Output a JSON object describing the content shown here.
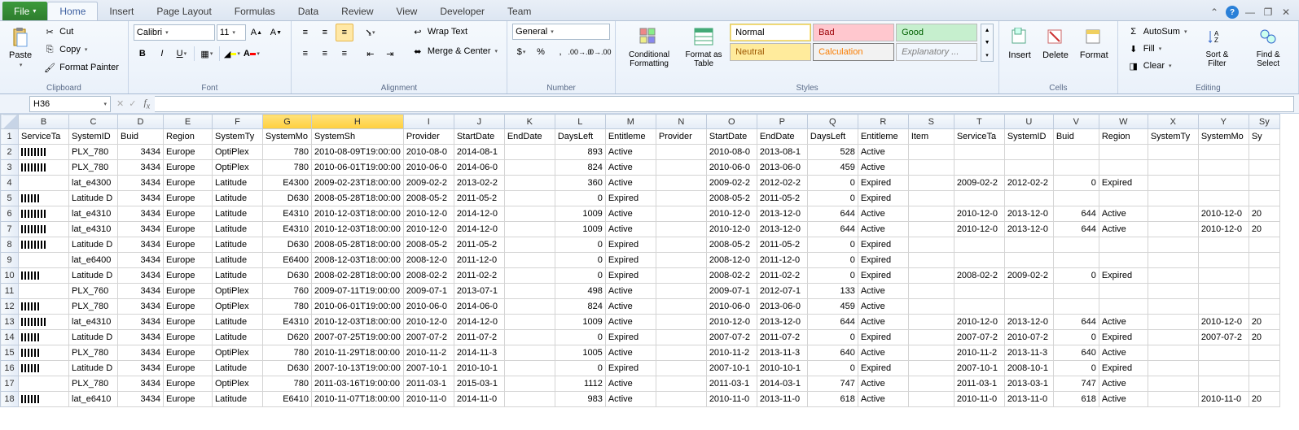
{
  "tabs": {
    "file": "File",
    "home": "Home",
    "insert": "Insert",
    "page_layout": "Page Layout",
    "formulas": "Formulas",
    "data": "Data",
    "review": "Review",
    "view": "View",
    "developer": "Developer",
    "team": "Team"
  },
  "clipboard": {
    "group": "Clipboard",
    "paste": "Paste",
    "cut": "Cut",
    "copy": "Copy",
    "format_painter": "Format Painter"
  },
  "font": {
    "group": "Font",
    "name": "Calibri",
    "size": "11"
  },
  "alignment": {
    "group": "Alignment",
    "wrap": "Wrap Text",
    "merge": "Merge & Center"
  },
  "number": {
    "group": "Number",
    "format": "General"
  },
  "styles": {
    "group": "Styles",
    "cond": "Conditional Formatting",
    "table": "Format as Table",
    "normal": "Normal",
    "bad": "Bad",
    "good": "Good",
    "neutral": "Neutral",
    "calc": "Calculation",
    "expl": "Explanatory ..."
  },
  "cells": {
    "group": "Cells",
    "insert": "Insert",
    "delete": "Delete",
    "format": "Format"
  },
  "editing": {
    "group": "Editing",
    "autosum": "AutoSum",
    "fill": "Fill",
    "clear": "Clear",
    "sort": "Sort & Filter",
    "find": "Find & Select"
  },
  "namebox": "H36",
  "columns": [
    "B",
    "C",
    "D",
    "E",
    "F",
    "G",
    "H",
    "I",
    "J",
    "K",
    "L",
    "M",
    "N",
    "O",
    "P",
    "Q",
    "R",
    "S",
    "T",
    "U",
    "V",
    "W",
    "X",
    "Y",
    "Sy"
  ],
  "headers": {
    "B": "ServiceTa",
    "C": "SystemID",
    "D": "Buid",
    "E": "Region",
    "F": "SystemTy",
    "G": "SystemMo",
    "H": "SystemSh",
    "I": "Provider",
    "J": "StartDate",
    "K": "EndDate",
    "L": "DaysLeft",
    "M": "Entitleme",
    "N": "Provider",
    "O": "StartDate",
    "P": "EndDate",
    "Q": "DaysLeft",
    "R": "Entitleme",
    "S": "Item",
    "T": "ServiceTa",
    "U": "SystemID",
    "V": "Buid",
    "W": "Region",
    "X": "SystemTy",
    "Y": "SystemMo",
    "Z": "Sy"
  },
  "rows": [
    {
      "n": 2,
      "bc": 1,
      "C": "PLX_780",
      "D": "3434",
      "E": "Europe",
      "F": "OptiPlex",
      "G": "780",
      "H": "2010-08-09T19:00:00",
      "I": "2010-08-0",
      "J": "2014-08-1",
      "K": "",
      "L": "893",
      "M": "Active",
      "O": "2010-08-0",
      "P": "2013-08-1",
      "Q": "528",
      "R": "Active"
    },
    {
      "n": 3,
      "bc": 1,
      "C": "PLX_780",
      "D": "3434",
      "E": "Europe",
      "F": "OptiPlex",
      "G": "780",
      "H": "2010-06-01T19:00:00",
      "I": "2010-06-0",
      "J": "2014-06-0",
      "K": "",
      "L": "824",
      "M": "Active",
      "O": "2010-06-0",
      "P": "2013-06-0",
      "Q": "459",
      "R": "Active"
    },
    {
      "n": 4,
      "bc": 0,
      "C": "lat_e4300",
      "D": "3434",
      "E": "Europe",
      "F": "Latitude",
      "G": "E4300",
      "H": "2009-02-23T18:00:00",
      "I": "2009-02-2",
      "J": "2013-02-2",
      "K": "",
      "L": "360",
      "M": "Active",
      "O": "2009-02-2",
      "P": "2012-02-2",
      "Q": "0",
      "R": "Expired",
      "T": "2009-02-2",
      "U": "2012-02-2",
      "V": "0",
      "W": "Expired"
    },
    {
      "n": 5,
      "bc": 2,
      "C": "Latitude D",
      "D": "3434",
      "E": "Europe",
      "F": "Latitude",
      "G": "D630",
      "H": "2008-05-28T18:00:00",
      "I": "2008-05-2",
      "J": "2011-05-2",
      "K": "",
      "L": "0",
      "M": "Expired",
      "O": "2008-05-2",
      "P": "2011-05-2",
      "Q": "0",
      "R": "Expired"
    },
    {
      "n": 6,
      "bc": 1,
      "C": "lat_e4310",
      "D": "3434",
      "E": "Europe",
      "F": "Latitude",
      "G": "E4310",
      "H": "2010-12-03T18:00:00",
      "I": "2010-12-0",
      "J": "2014-12-0",
      "K": "",
      "L": "1009",
      "M": "Active",
      "O": "2010-12-0",
      "P": "2013-12-0",
      "Q": "644",
      "R": "Active",
      "T": "2010-12-0",
      "U": "2013-12-0",
      "V": "644",
      "W": "Active",
      "Y": "2010-12-0",
      "Z": "20"
    },
    {
      "n": 7,
      "bc": 1,
      "C": "lat_e4310",
      "D": "3434",
      "E": "Europe",
      "F": "Latitude",
      "G": "E4310",
      "H": "2010-12-03T18:00:00",
      "I": "2010-12-0",
      "J": "2014-12-0",
      "K": "",
      "L": "1009",
      "M": "Active",
      "O": "2010-12-0",
      "P": "2013-12-0",
      "Q": "644",
      "R": "Active",
      "T": "2010-12-0",
      "U": "2013-12-0",
      "V": "644",
      "W": "Active",
      "Y": "2010-12-0",
      "Z": "20"
    },
    {
      "n": 8,
      "bc": 1,
      "C": "Latitude D",
      "D": "3434",
      "E": "Europe",
      "F": "Latitude",
      "G": "D630",
      "H": "2008-05-28T18:00:00",
      "I": "2008-05-2",
      "J": "2011-05-2",
      "K": "",
      "L": "0",
      "M": "Expired",
      "O": "2008-05-2",
      "P": "2011-05-2",
      "Q": "0",
      "R": "Expired"
    },
    {
      "n": 9,
      "bc": 0,
      "C": "lat_e6400",
      "D": "3434",
      "E": "Europe",
      "F": "Latitude",
      "G": "E6400",
      "H": "2008-12-03T18:00:00",
      "I": "2008-12-0",
      "J": "2011-12-0",
      "K": "",
      "L": "0",
      "M": "Expired",
      "O": "2008-12-0",
      "P": "2011-12-0",
      "Q": "0",
      "R": "Expired"
    },
    {
      "n": 10,
      "bc": 2,
      "C": "Latitude D",
      "D": "3434",
      "E": "Europe",
      "F": "Latitude",
      "G": "D630",
      "H": "2008-02-28T18:00:00",
      "I": "2008-02-2",
      "J": "2011-02-2",
      "K": "",
      "L": "0",
      "M": "Expired",
      "O": "2008-02-2",
      "P": "2011-02-2",
      "Q": "0",
      "R": "Expired",
      "T": "2008-02-2",
      "U": "2009-02-2",
      "V": "0",
      "W": "Expired"
    },
    {
      "n": 11,
      "bc": 0,
      "C": "PLX_760",
      "D": "3434",
      "E": "Europe",
      "F": "OptiPlex",
      "G": "760",
      "H": "2009-07-11T19:00:00",
      "I": "2009-07-1",
      "J": "2013-07-1",
      "K": "",
      "L": "498",
      "M": "Active",
      "O": "2009-07-1",
      "P": "2012-07-1",
      "Q": "133",
      "R": "Active"
    },
    {
      "n": 12,
      "bc": 2,
      "C": "PLX_780",
      "D": "3434",
      "E": "Europe",
      "F": "OptiPlex",
      "G": "780",
      "H": "2010-06-01T19:00:00",
      "I": "2010-06-0",
      "J": "2014-06-0",
      "K": "",
      "L": "824",
      "M": "Active",
      "O": "2010-06-0",
      "P": "2013-06-0",
      "Q": "459",
      "R": "Active"
    },
    {
      "n": 13,
      "bc": 1,
      "C": "lat_e4310",
      "D": "3434",
      "E": "Europe",
      "F": "Latitude",
      "G": "E4310",
      "H": "2010-12-03T18:00:00",
      "I": "2010-12-0",
      "J": "2014-12-0",
      "K": "",
      "L": "1009",
      "M": "Active",
      "O": "2010-12-0",
      "P": "2013-12-0",
      "Q": "644",
      "R": "Active",
      "T": "2010-12-0",
      "U": "2013-12-0",
      "V": "644",
      "W": "Active",
      "Y": "2010-12-0",
      "Z": "20"
    },
    {
      "n": 14,
      "bc": 2,
      "C": "Latitude D",
      "D": "3434",
      "E": "Europe",
      "F": "Latitude",
      "G": "D620",
      "H": "2007-07-25T19:00:00",
      "I": "2007-07-2",
      "J": "2011-07-2",
      "K": "",
      "L": "0",
      "M": "Expired",
      "O": "2007-07-2",
      "P": "2011-07-2",
      "Q": "0",
      "R": "Expired",
      "T": "2007-07-2",
      "U": "2010-07-2",
      "V": "0",
      "W": "Expired",
      "Y": "2007-07-2",
      "Z": "20"
    },
    {
      "n": 15,
      "bc": 2,
      "C": "PLX_780",
      "D": "3434",
      "E": "Europe",
      "F": "OptiPlex",
      "G": "780",
      "H": "2010-11-29T18:00:00",
      "I": "2010-11-2",
      "J": "2014-11-3",
      "K": "",
      "L": "1005",
      "M": "Active",
      "O": "2010-11-2",
      "P": "2013-11-3",
      "Q": "640",
      "R": "Active",
      "T": "2010-11-2",
      "U": "2013-11-3",
      "V": "640",
      "W": "Active"
    },
    {
      "n": 16,
      "bc": 2,
      "C": "Latitude D",
      "D": "3434",
      "E": "Europe",
      "F": "Latitude",
      "G": "D630",
      "H": "2007-10-13T19:00:00",
      "I": "2007-10-1",
      "J": "2010-10-1",
      "K": "",
      "L": "0",
      "M": "Expired",
      "O": "2007-10-1",
      "P": "2010-10-1",
      "Q": "0",
      "R": "Expired",
      "T": "2007-10-1",
      "U": "2008-10-1",
      "V": "0",
      "W": "Expired"
    },
    {
      "n": 17,
      "bc": 0,
      "C": "PLX_780",
      "D": "3434",
      "E": "Europe",
      "F": "OptiPlex",
      "G": "780",
      "H": "2011-03-16T19:00:00",
      "I": "2011-03-1",
      "J": "2015-03-1",
      "K": "",
      "L": "1112",
      "M": "Active",
      "O": "2011-03-1",
      "P": "2014-03-1",
      "Q": "747",
      "R": "Active",
      "T": "2011-03-1",
      "U": "2013-03-1",
      "V": "747",
      "W": "Active"
    },
    {
      "n": 18,
      "bc": 2,
      "C": "lat_e6410",
      "D": "3434",
      "E": "Europe",
      "F": "Latitude",
      "G": "E6410",
      "H": "2010-11-07T18:00:00",
      "I": "2010-11-0",
      "J": "2014-11-0",
      "K": "",
      "L": "983",
      "M": "Active",
      "O": "2010-11-0",
      "P": "2013-11-0",
      "Q": "618",
      "R": "Active",
      "T": "2010-11-0",
      "U": "2013-11-0",
      "V": "618",
      "W": "Active",
      "Y": "2010-11-0",
      "Z": "20"
    }
  ]
}
